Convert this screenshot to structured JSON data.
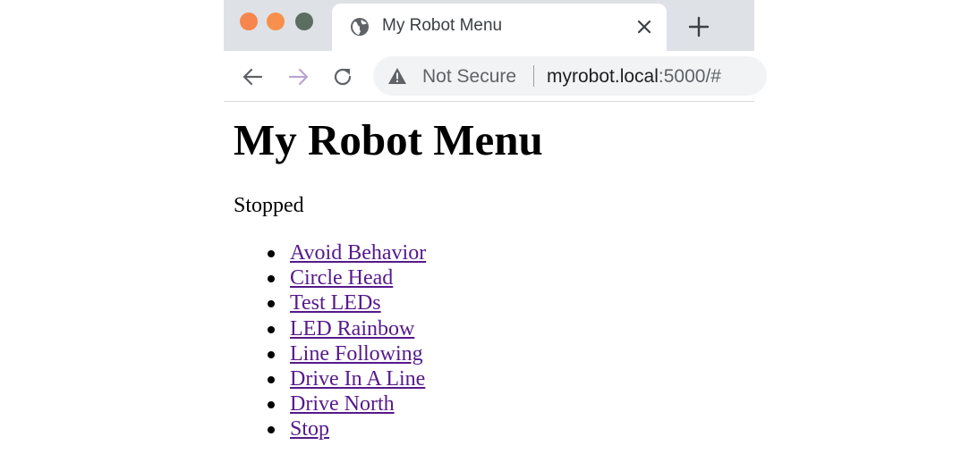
{
  "browser": {
    "tab": {
      "title": "My Robot Menu"
    },
    "address_bar": {
      "security_label": "Not Secure",
      "url_host": "myrobot.local",
      "url_rest": ":5000/#"
    },
    "colors": {
      "close": "#f7864d",
      "minimize": "#f7904c",
      "maximize": "#5b6e61",
      "link": "#551a8b"
    }
  },
  "page": {
    "heading": "My Robot Menu",
    "status": "Stopped",
    "menu_items": [
      {
        "label": "Avoid Behavior"
      },
      {
        "label": "Circle Head"
      },
      {
        "label": "Test LEDs"
      },
      {
        "label": "LED Rainbow"
      },
      {
        "label": "Line Following"
      },
      {
        "label": "Drive In A Line"
      },
      {
        "label": "Drive North"
      },
      {
        "label": "Stop"
      }
    ]
  }
}
